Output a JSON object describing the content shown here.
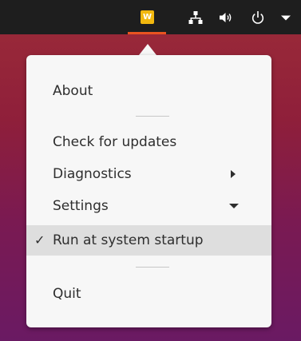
{
  "topbar": {
    "app_indicator_letter": "W",
    "icons": [
      "app-indicator-icon",
      "network-wired-icon",
      "volume-icon",
      "power-icon",
      "dropdown-arrow-icon"
    ],
    "colors": {
      "bar": "#1e1e1e",
      "indicator": "#f2b80f",
      "underline": "#e95420"
    }
  },
  "menu": {
    "items": [
      {
        "label": "About"
      },
      {
        "label": "Check for updates"
      },
      {
        "label": "Diagnostics",
        "submenu": "right"
      },
      {
        "label": "Settings",
        "submenu": "down"
      },
      {
        "label": "Run at system startup",
        "checked": true,
        "check_mark": "✓"
      },
      {
        "label": "Quit"
      }
    ]
  }
}
